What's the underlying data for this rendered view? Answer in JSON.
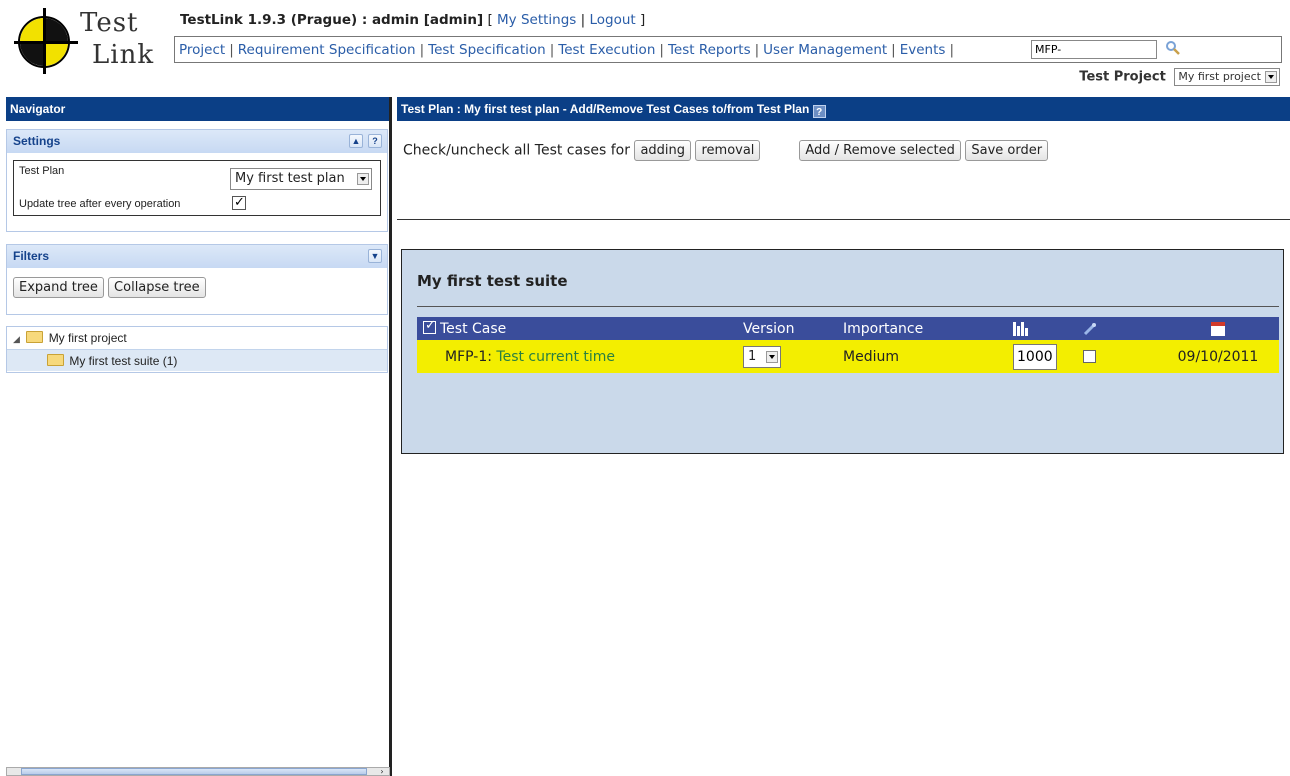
{
  "header": {
    "logo_line1": "Test",
    "logo_line2": "Link",
    "title": "TestLink 1.9.3 (Prague) : admin [admin]",
    "open_bracket": " [ ",
    "my_settings": "My Settings",
    "pipe": " | ",
    "logout": "Logout",
    "close_bracket": " ]",
    "menu": [
      "Project",
      "Requirement Specification",
      "Test Specification",
      "Test Execution",
      "Test Reports",
      "User Management",
      "Events"
    ],
    "menu_separator": "|",
    "search_value": "MFP-",
    "project_label": "Test Project",
    "project_selected": "My first project"
  },
  "navigator": {
    "title": "Navigator",
    "settings": {
      "title": "Settings",
      "test_plan_label": "Test Plan",
      "test_plan_selected": "My first test plan",
      "update_tree_label": "Update tree after every operation",
      "update_tree_checked": true
    },
    "filters": {
      "title": "Filters",
      "expand_label": "Expand tree",
      "collapse_label": "Collapse tree"
    },
    "tree": {
      "root": "My first project",
      "suite": "My first test suite (1)"
    }
  },
  "content": {
    "title": "Test Plan : My first test plan - Add/Remove Test Cases to/from Test Plan",
    "check_label": "Check/uncheck all Test cases for",
    "adding_label": "adding",
    "removal_label": "removal",
    "add_remove_label": "Add / Remove selected",
    "save_order_label": "Save order",
    "suite": {
      "title": "My first test suite",
      "columns": {
        "test_case": "Test Case",
        "version": "Version",
        "importance": "Importance"
      },
      "rows": [
        {
          "id": "MFP-1:",
          "name": "Test current time",
          "version": "1",
          "importance": "Medium",
          "order": "1000",
          "date": "09/10/2011"
        }
      ]
    }
  },
  "icons": [
    "search-icon",
    "help-icon",
    "collapse-up-icon",
    "dropdown-arrow-icon",
    "folder-icon",
    "priority-icon",
    "link-icon",
    "calendar-icon"
  ],
  "colors": {
    "nav_header": "#0b3f86",
    "table_header": "#3a4d9b",
    "row_highlight": "#f3ee00",
    "suite_background": "#cad9ea",
    "link": "#2a5da8"
  }
}
